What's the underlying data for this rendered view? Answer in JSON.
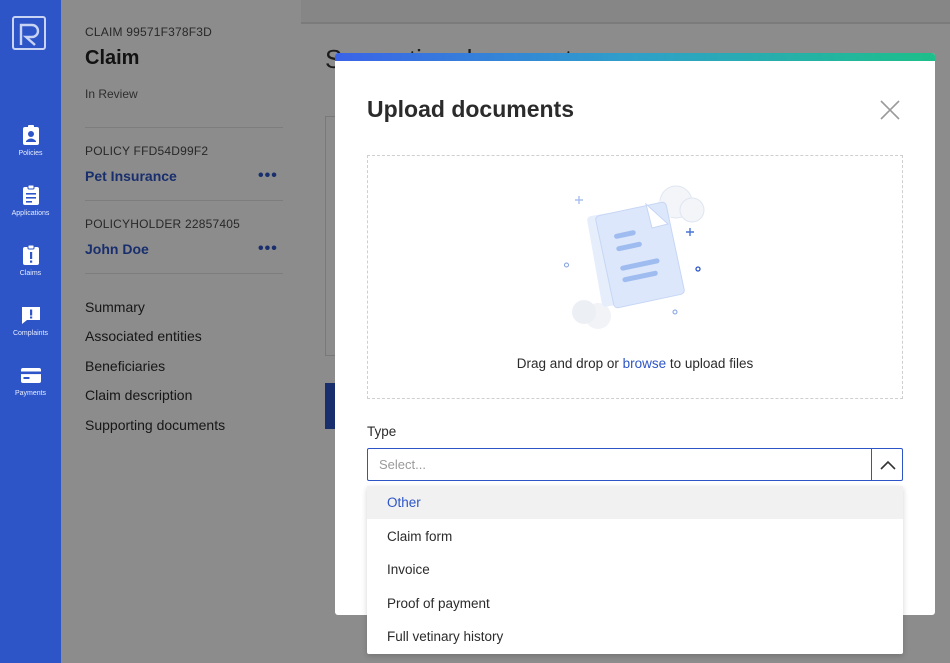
{
  "nav": {
    "items": [
      {
        "label": "Policies",
        "icon": "id-badge-icon"
      },
      {
        "label": "Applications",
        "icon": "clipboard-icon"
      },
      {
        "label": "Claims",
        "icon": "claims-alert-icon"
      },
      {
        "label": "Complaints",
        "icon": "chat-alert-icon"
      },
      {
        "label": "Payments",
        "icon": "credit-card-icon"
      }
    ]
  },
  "claim": {
    "id_label": "CLAIM 99571F378F3D",
    "title": "Claim",
    "status": "In Review",
    "policy_label": "POLICY FFD54D99F2",
    "policy_name": "Pet Insurance",
    "policyholder_label": "POLICYHOLDER 22857405",
    "policyholder_name": "John Doe",
    "more_label": "•••",
    "menu": [
      "Summary",
      "Associated entities",
      "Beneficiaries",
      "Claim description",
      "Supporting documents"
    ]
  },
  "main": {
    "heading": "Supporting documents"
  },
  "modal": {
    "title": "Upload documents",
    "drop_text_before": "Drag and drop or ",
    "drop_browse": "browse",
    "drop_text_after": " to upload files",
    "type_label": "Type",
    "select_placeholder": "Select...",
    "options": [
      "Other",
      "Claim form",
      "Invoice",
      "Proof of payment",
      "Full vetinary history"
    ],
    "active_option": "Other"
  },
  "colors": {
    "primary": "#2d55c7",
    "gradient_start": "#3a63e8",
    "gradient_end": "#1dbf8a"
  }
}
